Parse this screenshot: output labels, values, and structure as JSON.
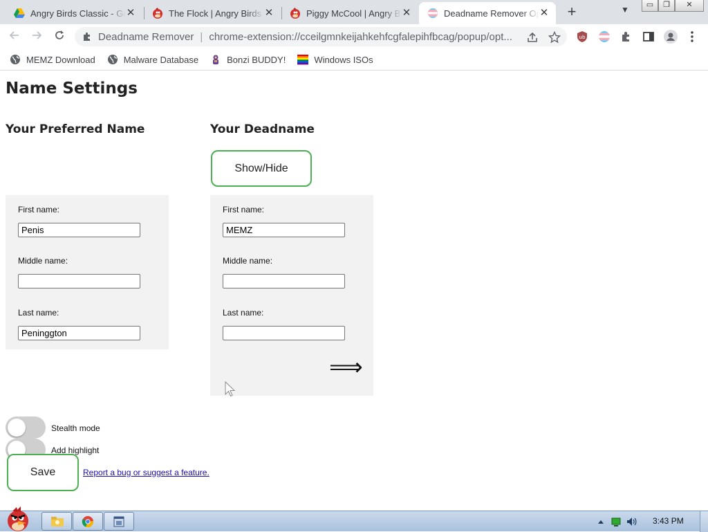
{
  "browser": {
    "tabs": [
      {
        "title": "Angry Birds Classic - Go",
        "icon": "google-drive-icon",
        "active": false
      },
      {
        "title": "The Flock | Angry Birds",
        "icon": "angry-bird-icon",
        "active": false
      },
      {
        "title": "Piggy McCool | Angry B",
        "icon": "angry-bird-icon",
        "active": false
      },
      {
        "title": "Deadname Remover Opt",
        "icon": "trans-flag-icon",
        "active": true
      }
    ],
    "window_controls": {
      "minimize": "▭",
      "restore": "❐",
      "close": "✕"
    },
    "address": {
      "title": "Deadname Remover",
      "url": "chrome-extension://cceilgmnkeijahkehfcgfalepihfbcag/popup/opt..."
    },
    "bookmarks": [
      {
        "label": "MEMZ Download",
        "icon": "globe-icon"
      },
      {
        "label": "Malware Database",
        "icon": "globe-icon"
      },
      {
        "label": "Bonzi BUDDY!",
        "icon": "bonzi-icon"
      },
      {
        "label": "Windows ISOs",
        "icon": "rainbow-flag-icon"
      }
    ]
  },
  "page": {
    "title": "Name Settings",
    "preferred": {
      "heading": "Your Preferred Name",
      "first_label": "First name:",
      "first_value": "Penis",
      "middle_label": "Middle name:",
      "middle_value": "",
      "last_label": "Last name:",
      "last_value": "Peninggton"
    },
    "deadname": {
      "heading": "Your Deadname",
      "show_hide_label": "Show/Hide",
      "first_label": "First name:",
      "first_value": "MEMZ",
      "middle_label": "Middle name:",
      "middle_value": "",
      "last_label": "Last name:",
      "last_value": "",
      "arrow": "⟹"
    },
    "stealth_label": "Stealth mode",
    "stealth_on": false,
    "highlight_label": "Add highlight",
    "highlight_on": false,
    "save_label": "Save",
    "report_link": "Report a bug or suggest a feature."
  },
  "taskbar": {
    "clock": "3:43 PM",
    "accent": "#4caf50"
  }
}
